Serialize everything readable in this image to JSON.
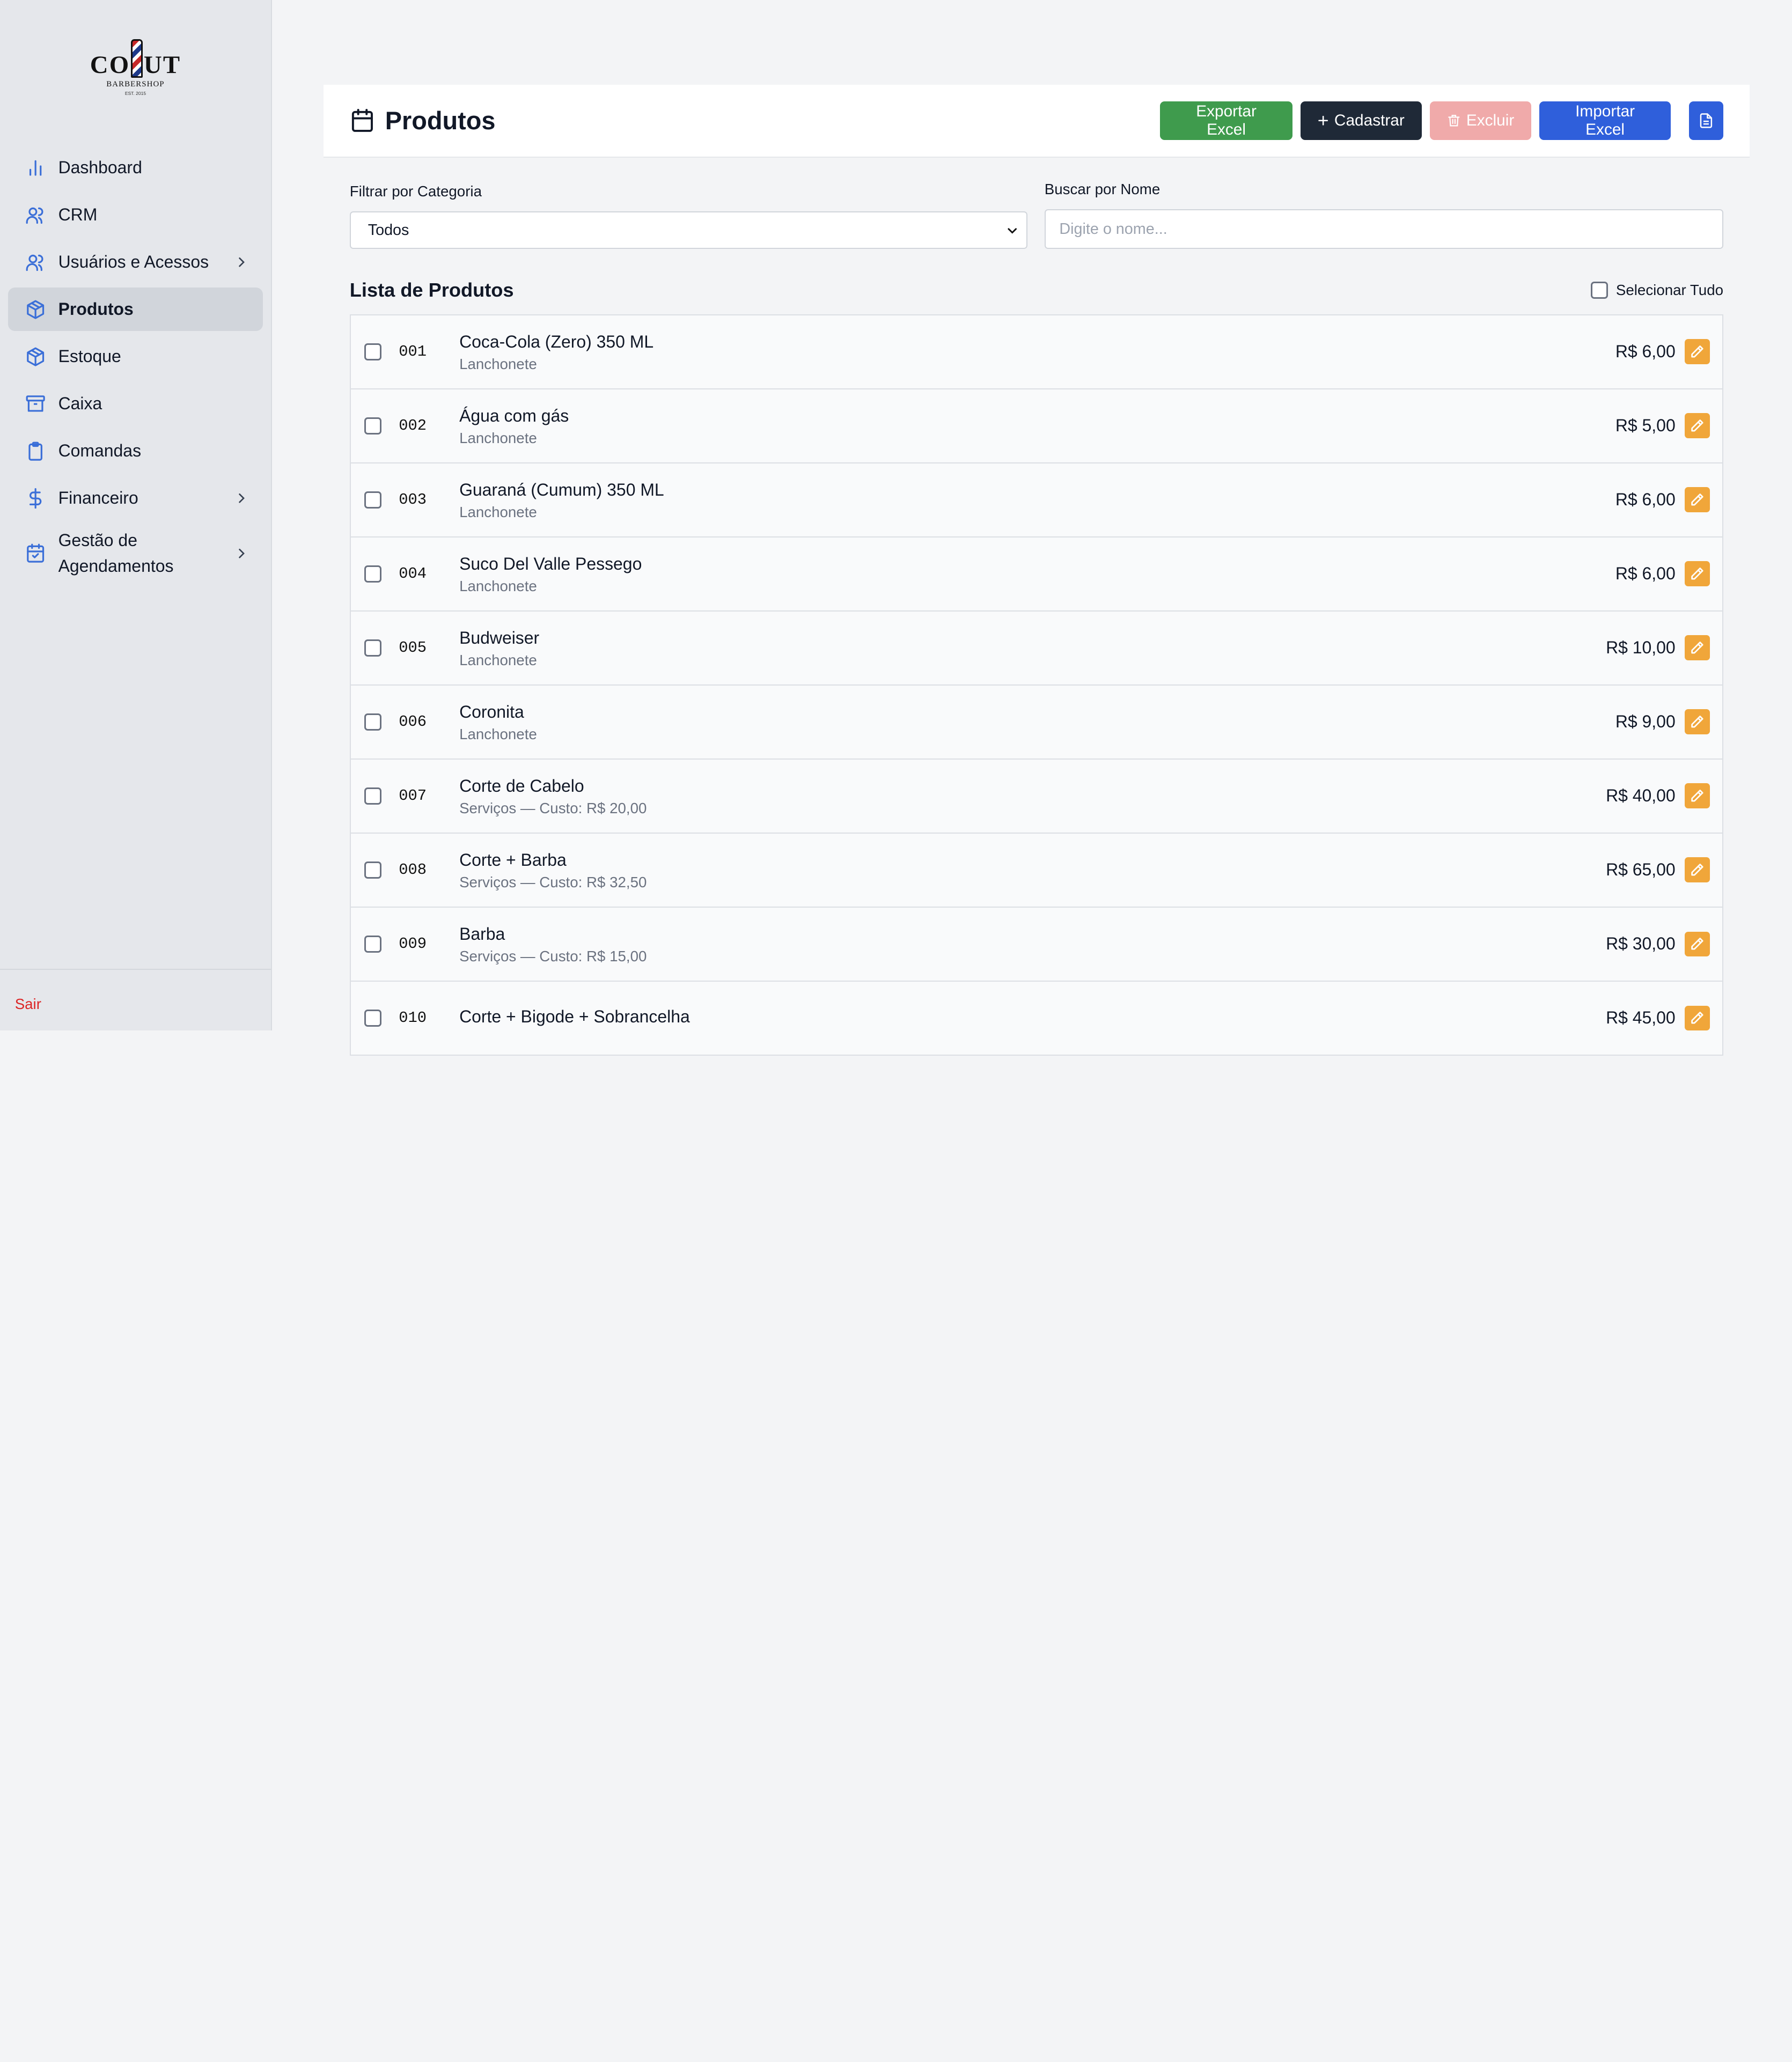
{
  "brand": {
    "logo_left": "CO",
    "logo_right": "UT",
    "logo_sub": "BARBERSHOP",
    "logo_est": "EST. 2015"
  },
  "sidebar": {
    "items": [
      {
        "label": "Dashboard",
        "icon": "bar-chart-icon"
      },
      {
        "label": "CRM",
        "icon": "users-icon"
      },
      {
        "label": "Usuários e Acessos",
        "icon": "users-icon",
        "has_submenu": true
      },
      {
        "label": "Produtos",
        "icon": "box-icon",
        "active": true
      },
      {
        "label": "Estoque",
        "icon": "box-icon"
      },
      {
        "label": "Caixa",
        "icon": "archive-icon"
      },
      {
        "label": "Comandas",
        "icon": "clipboard-icon"
      },
      {
        "label": "Financeiro",
        "icon": "dollar-icon",
        "has_submenu": true
      },
      {
        "label": "Gestão de Agendamentos",
        "icon": "calendar-check-icon",
        "has_submenu": true
      }
    ],
    "logout_label": "Sair"
  },
  "header": {
    "title": "Produtos",
    "buttons": {
      "export": "Exportar Excel",
      "create": "Cadastrar",
      "delete": "Excluir",
      "import": "Importar Excel"
    }
  },
  "filters": {
    "category_label": "Filtrar por Categoria",
    "category_value": "Todos",
    "name_label": "Buscar por Nome",
    "name_placeholder": "Digite o nome...",
    "name_value": ""
  },
  "list": {
    "title": "Lista de Produtos",
    "select_all_label": "Selecionar Tudo",
    "rows": [
      {
        "code": "001",
        "name": "Coca-Cola (Zero) 350 ML",
        "sub": "Lanchonete",
        "price": "R$ 6,00"
      },
      {
        "code": "002",
        "name": "Água com gás",
        "sub": "Lanchonete",
        "price": "R$ 5,00"
      },
      {
        "code": "003",
        "name": "Guaraná (Cumum) 350 ML",
        "sub": "Lanchonete",
        "price": "R$ 6,00"
      },
      {
        "code": "004",
        "name": "Suco Del Valle Pessego",
        "sub": "Lanchonete",
        "price": "R$ 6,00"
      },
      {
        "code": "005",
        "name": "Budweiser",
        "sub": "Lanchonete",
        "price": "R$ 10,00"
      },
      {
        "code": "006",
        "name": "Coronita",
        "sub": "Lanchonete",
        "price": "R$ 9,00"
      },
      {
        "code": "007",
        "name": "Corte de Cabelo",
        "sub": "Serviços — Custo: R$ 20,00",
        "price": "R$ 40,00"
      },
      {
        "code": "008",
        "name": "Corte + Barba",
        "sub": "Serviços — Custo: R$ 32,50",
        "price": "R$ 65,00"
      },
      {
        "code": "009",
        "name": "Barba",
        "sub": "Serviços — Custo: R$ 15,00",
        "price": "R$ 30,00"
      },
      {
        "code": "010",
        "name": "Corte + Bigode + Sobrancelha",
        "sub": "",
        "price": "R$ 45,00"
      }
    ]
  },
  "colors": {
    "export_button": "#3f9b4d",
    "create_button": "#1f2937",
    "delete_button_disabled": "#f0aaaa",
    "import_button": "#2f5fdb",
    "edit_button": "#f0a63a",
    "nav_icon": "#3b6fd8",
    "logout": "#dc2626"
  }
}
